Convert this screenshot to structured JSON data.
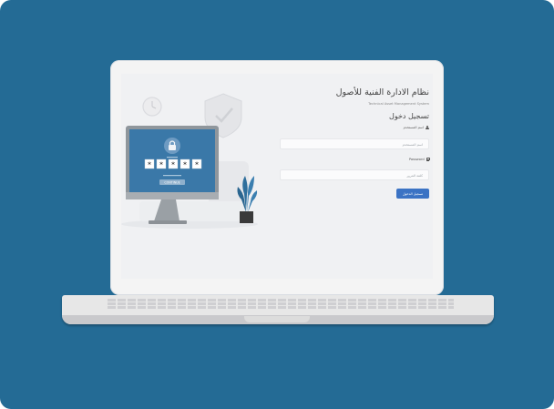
{
  "app": {
    "title": "نظام الادارة الفنية للأصول",
    "subtitle": "Technical Asset Management System"
  },
  "login": {
    "heading": "تسجيل دخول",
    "username_label": "اسم المستخدم",
    "username_placeholder": "اسم المستخدم",
    "password_label": "Password",
    "password_placeholder": "كلمة المرور",
    "submit_label": "تسجيل الدخول"
  },
  "illustration": {
    "continue_label": "CONTINUE",
    "password_mask": [
      "*",
      "*",
      "*",
      "*",
      "*"
    ]
  },
  "colors": {
    "background": "#246b95",
    "accent": "#3b73c4",
    "monitor_screen": "#3a78a8"
  },
  "icons": {
    "username": "user-icon",
    "password": "lock-icon",
    "monitor_lock": "padlock-icon",
    "shield": "shield-icon",
    "clock": "clock-icon",
    "plant": "plant-icon"
  }
}
